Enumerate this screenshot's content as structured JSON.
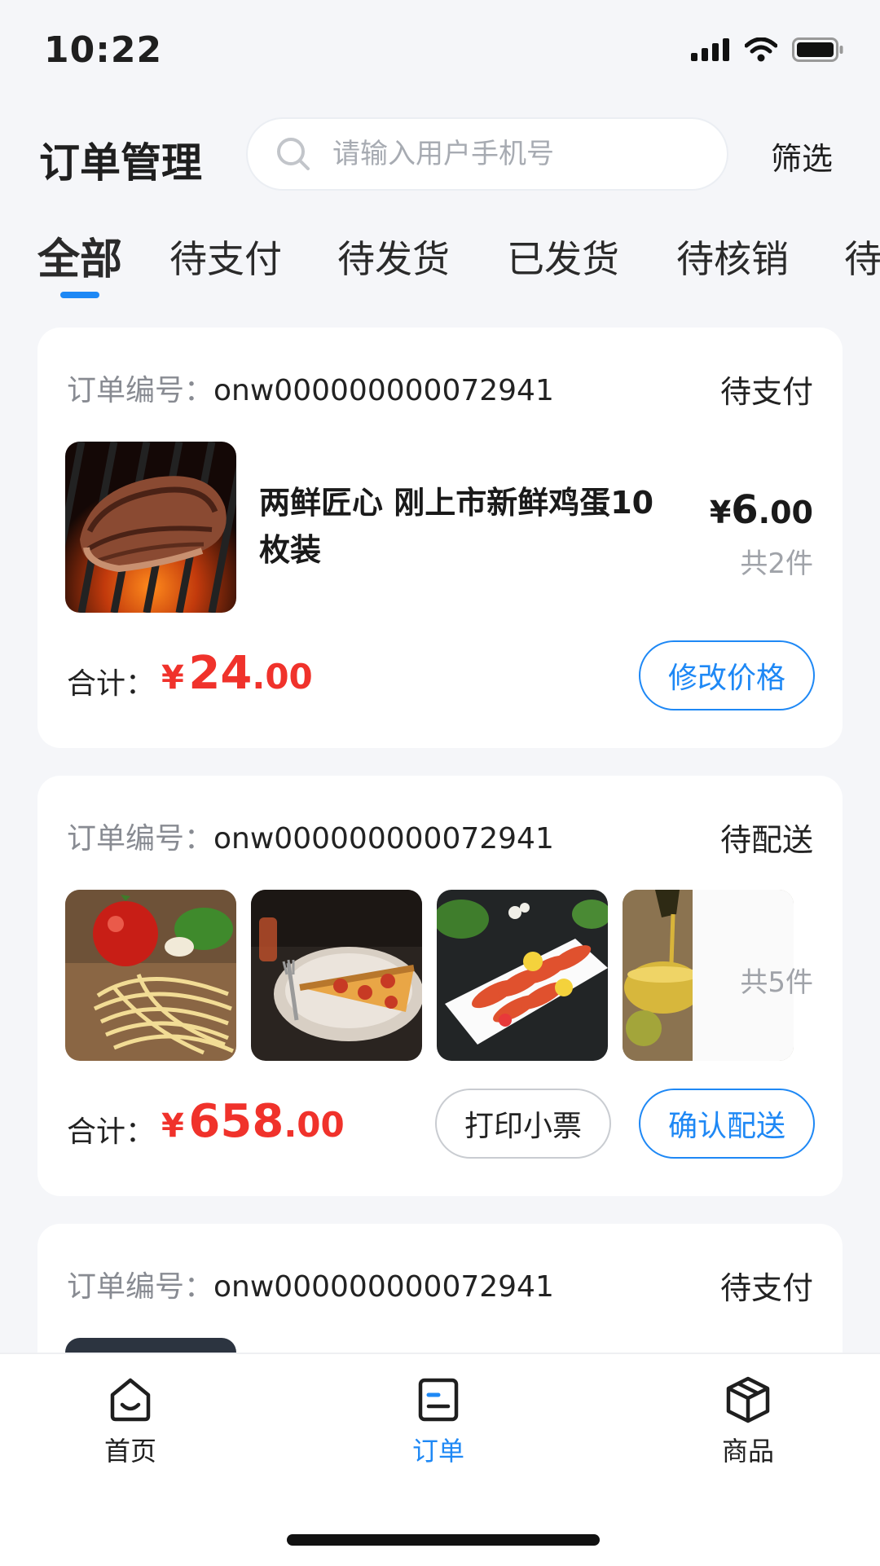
{
  "status_bar": {
    "time": "10:22",
    "icons": [
      "cellular-signal-icon",
      "wifi-icon",
      "battery-icon"
    ]
  },
  "header": {
    "title": "订单管理",
    "search_placeholder": "请输入用户手机号",
    "filter_label": "筛选"
  },
  "tabs": [
    {
      "label": "全部",
      "active": true
    },
    {
      "label": "待支付",
      "active": false
    },
    {
      "label": "待发货",
      "active": false
    },
    {
      "label": "已发货",
      "active": false
    },
    {
      "label": "待核销",
      "active": false
    },
    {
      "label": "待",
      "active": false
    }
  ],
  "orders": [
    {
      "order_no_label": "订单编号：",
      "order_no": "onw000000000072941",
      "status": "待支付",
      "product_name": "两鲜匠心 刚上市新鲜鸡蛋10枚装",
      "unit_price_symbol": "¥",
      "unit_price_int": "6",
      "unit_price_dec": ".00",
      "count": "共2件",
      "total_label": "合计：",
      "total_symbol": "¥",
      "total_int": "24",
      "total_dec": ".00",
      "actions": [
        "修改价格"
      ]
    },
    {
      "order_no_label": "订单编号：",
      "order_no": "onw000000000072941",
      "status": "待配送",
      "count": "共5件",
      "total_label": "合计：",
      "total_symbol": "¥",
      "total_int": "658",
      "total_dec": ".00",
      "actions": [
        "打印小票",
        "确认配送"
      ]
    },
    {
      "order_no_label": "订单编号：",
      "order_no": "onw000000000072941",
      "status": "待支付"
    }
  ],
  "bottom_nav": [
    {
      "label": "首页",
      "icon": "home-icon",
      "active": false
    },
    {
      "label": "订单",
      "icon": "order-icon",
      "active": true
    },
    {
      "label": "商品",
      "icon": "box-icon",
      "active": false
    }
  ],
  "colors": {
    "accent": "#1e88f5",
    "price_red": "#f0322b",
    "background": "#f5f6f9"
  }
}
